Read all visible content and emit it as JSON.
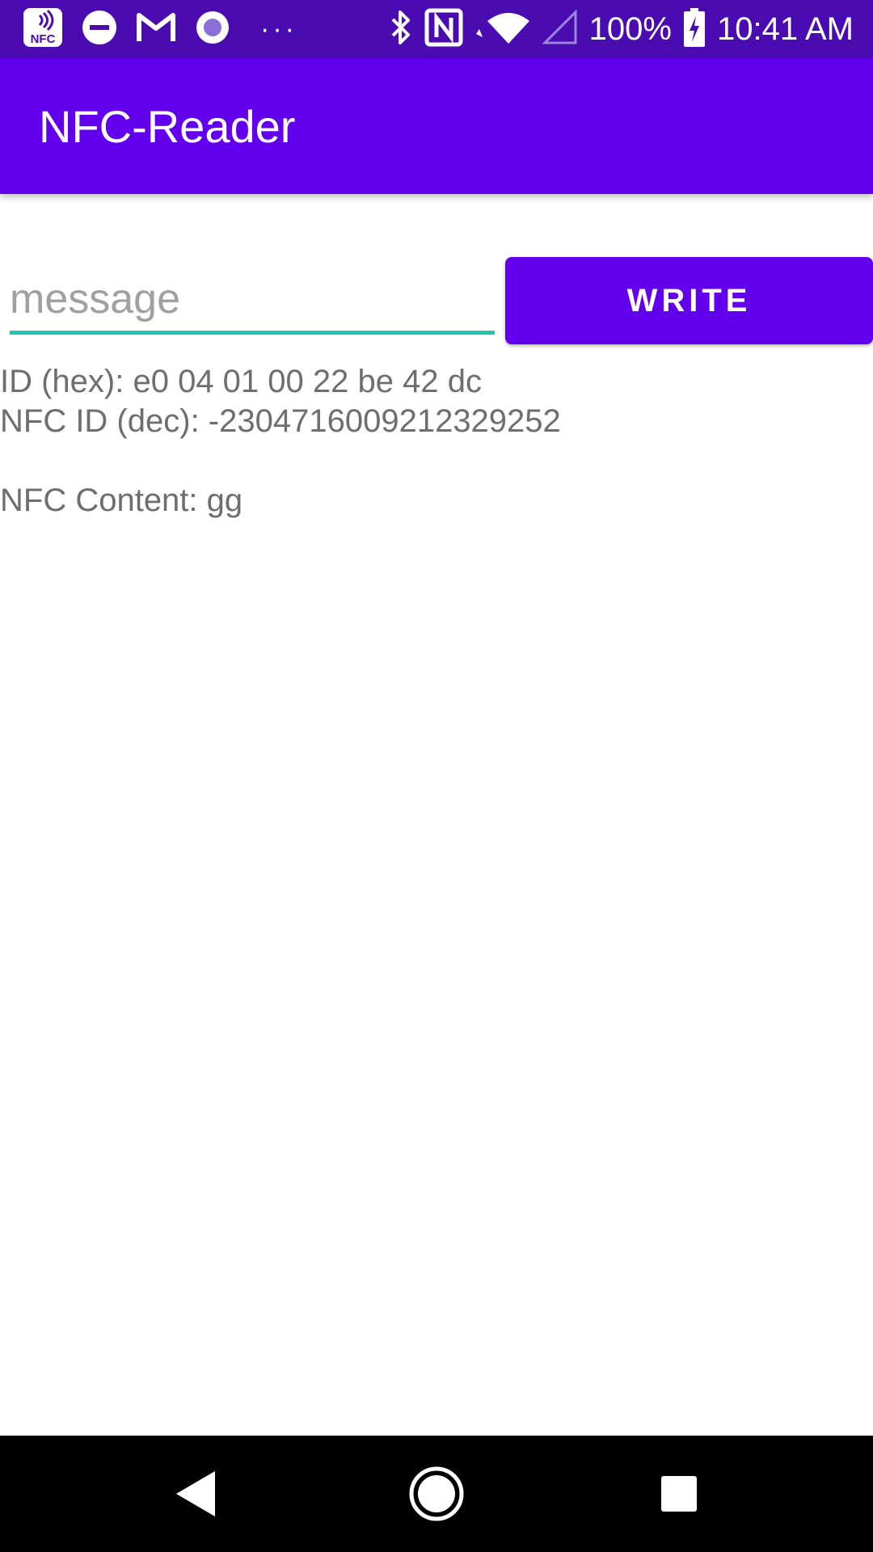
{
  "status_bar": {
    "icons_left": [
      "nfc-app-icon",
      "do-not-disturb-icon",
      "gmail-icon",
      "record-icon",
      "more-dots-icon"
    ],
    "more_dots": "···",
    "icons_right": [
      "bluetooth-icon",
      "nfc-icon",
      "wifi-icon",
      "cell-signal-icon",
      "battery-charging-icon"
    ],
    "battery": "100%",
    "time": "10:41 AM",
    "nfc_icon_text": "NFC"
  },
  "app_bar": {
    "title": "NFC-Reader"
  },
  "form": {
    "message_placeholder": "message",
    "message_value": "",
    "write_label": "WRITE"
  },
  "info": {
    "id_hex": "ID (hex): e0 04 01 00 22 be 42 dc",
    "id_dec": "NFC ID (dec): -2304716009212329252",
    "content": "NFC Content: gg"
  },
  "nav": {
    "icons": [
      "back-icon",
      "home-icon",
      "recents-icon"
    ]
  },
  "colors": {
    "status_bar": "#4a0bb0",
    "primary": "#6200ee",
    "accent": "#21c7b0",
    "text_secondary": "#6e6e6e"
  }
}
